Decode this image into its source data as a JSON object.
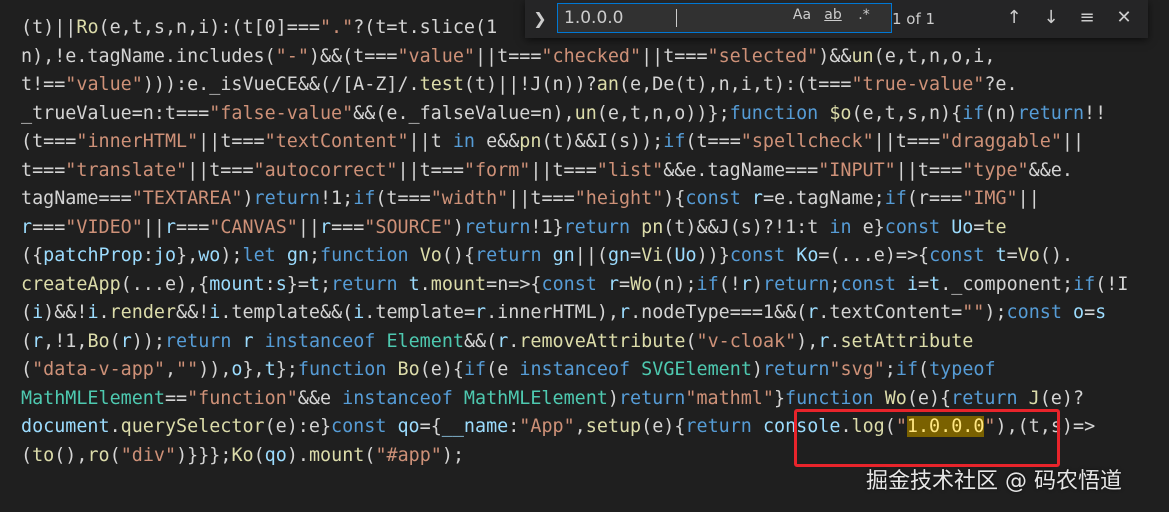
{
  "find": {
    "query": "1.0.0.0",
    "match_case_label": "Aa",
    "whole_word_label": "ab",
    "regex_label": ".*",
    "result_count": "1 of 1"
  },
  "code_lines": [
    [
      [
        "w",
        "(t)||"
      ],
      [
        "f",
        "Ro"
      ],
      [
        "w",
        "(e,t,s,n,i):(t[0]==="
      ],
      [
        "s",
        "\".\""
      ],
      [
        "w",
        "?(t=t.slice(1"
      ]
    ],
    [
      [
        "w",
        "n),!e.tagName.includes("
      ],
      [
        "s",
        "\"-\""
      ],
      [
        "w",
        ")&&(t==="
      ],
      [
        "s",
        "\"value\""
      ],
      [
        "w",
        "||t==="
      ],
      [
        "s",
        "\"checked\""
      ],
      [
        "w",
        "||t==="
      ],
      [
        "s",
        "\"selected\""
      ],
      [
        "w",
        ")&&"
      ],
      [
        "f",
        "un"
      ],
      [
        "w",
        "(e,t,n,o,i,"
      ]
    ],
    [
      [
        "w",
        "t!=="
      ],
      [
        "s",
        "\"value\""
      ],
      [
        "w",
        "))):e._isVueCE&&(/[A-Z]/."
      ],
      [
        "f",
        "test"
      ],
      [
        "w",
        "(t)||!J(n))?"
      ],
      [
        "f",
        "an"
      ],
      [
        "w",
        "(e,De(t),n,i,t):(t==="
      ],
      [
        "s",
        "\"true-value\""
      ],
      [
        "w",
        "?e."
      ]
    ],
    [
      [
        "w",
        "_trueValue=n:t==="
      ],
      [
        "s",
        "\"false-value\""
      ],
      [
        "w",
        "&&(e._falseValue=n),"
      ],
      [
        "f",
        "un"
      ],
      [
        "w",
        "(e,t,n,o))};"
      ],
      [
        "k",
        "function "
      ],
      [
        "f",
        "$o"
      ],
      [
        "w",
        "(e,t,s,n){"
      ],
      [
        "k",
        "if"
      ],
      [
        "w",
        "(n)"
      ],
      [
        "k",
        "return"
      ],
      [
        "w",
        "!!"
      ]
    ],
    [
      [
        "w",
        "(t==="
      ],
      [
        "s",
        "\"innerHTML\""
      ],
      [
        "w",
        "||t==="
      ],
      [
        "s",
        "\"textContent\""
      ],
      [
        "w",
        "||t "
      ],
      [
        "k",
        "in"
      ],
      [
        "w",
        " e&&"
      ],
      [
        "f",
        "pn"
      ],
      [
        "w",
        "(t)&&I(s));"
      ],
      [
        "k",
        "if"
      ],
      [
        "w",
        "(t==="
      ],
      [
        "s",
        "\"spellcheck\""
      ],
      [
        "w",
        "||t==="
      ],
      [
        "s",
        "\"draggable\""
      ],
      [
        "w",
        "||"
      ]
    ],
    [
      [
        "w",
        "t==="
      ],
      [
        "s",
        "\"translate\""
      ],
      [
        "w",
        "||t==="
      ],
      [
        "s",
        "\"autocorrect\""
      ],
      [
        "w",
        "||t==="
      ],
      [
        "s",
        "\"form\""
      ],
      [
        "w",
        "||t==="
      ],
      [
        "s",
        "\"list\""
      ],
      [
        "w",
        "&&e.tagName==="
      ],
      [
        "s",
        "\"INPUT\""
      ],
      [
        "w",
        "||t==="
      ],
      [
        "s",
        "\"type\""
      ],
      [
        "w",
        "&&e."
      ]
    ],
    [
      [
        "w",
        "tagName==="
      ],
      [
        "s",
        "\"TEXTAREA\""
      ],
      [
        "w",
        ")"
      ],
      [
        "k",
        "return"
      ],
      [
        "w",
        "!1;"
      ],
      [
        "k",
        "if"
      ],
      [
        "w",
        "(t==="
      ],
      [
        "s",
        "\"width\""
      ],
      [
        "w",
        "||t==="
      ],
      [
        "s",
        "\"height\""
      ],
      [
        "w",
        "){"
      ],
      [
        "k",
        "const "
      ],
      [
        "v",
        "r"
      ],
      [
        "w",
        "=e.tagName;"
      ],
      [
        "k",
        "if"
      ],
      [
        "w",
        "(r==="
      ],
      [
        "s",
        "\"IMG\""
      ],
      [
        "w",
        "||"
      ]
    ],
    [
      [
        "v",
        "r"
      ],
      [
        "w",
        "==="
      ],
      [
        "s",
        "\"VIDEO\""
      ],
      [
        "w",
        "||"
      ],
      [
        "v",
        "r"
      ],
      [
        "w",
        "==="
      ],
      [
        "s",
        "\"CANVAS\""
      ],
      [
        "w",
        "||"
      ],
      [
        "v",
        "r"
      ],
      [
        "w",
        "==="
      ],
      [
        "s",
        "\"SOURCE\""
      ],
      [
        "w",
        ")"
      ],
      [
        "k",
        "return"
      ],
      [
        "w",
        "!1}"
      ],
      [
        "k",
        "return "
      ],
      [
        "f",
        "pn"
      ],
      [
        "w",
        "(t)&&J(s)?!1:t "
      ],
      [
        "k",
        "in"
      ],
      [
        "w",
        " e}"
      ],
      [
        "k",
        "const "
      ],
      [
        "v",
        "Uo"
      ],
      [
        "w",
        "="
      ],
      [
        "f",
        "te"
      ]
    ],
    [
      [
        "w",
        "({"
      ],
      [
        "v",
        "patchProp"
      ],
      [
        "w",
        ":"
      ],
      [
        "v",
        "jo"
      ],
      [
        "w",
        "},"
      ],
      [
        "v",
        "wo"
      ],
      [
        "w",
        ");"
      ],
      [
        "k",
        "let "
      ],
      [
        "v",
        "gn"
      ],
      [
        "w",
        ";"
      ],
      [
        "k",
        "function "
      ],
      [
        "f",
        "Vo"
      ],
      [
        "w",
        "(){"
      ],
      [
        "k",
        "return "
      ],
      [
        "v",
        "gn"
      ],
      [
        "w",
        "||("
      ],
      [
        "v",
        "gn"
      ],
      [
        "w",
        "="
      ],
      [
        "f",
        "Vi"
      ],
      [
        "w",
        "("
      ],
      [
        "v",
        "Uo"
      ],
      [
        "w",
        "))}"
      ],
      [
        "k",
        "const "
      ],
      [
        "v",
        "Ko"
      ],
      [
        "w",
        "=(...e)=>{"
      ],
      [
        "k",
        "const "
      ],
      [
        "v",
        "t"
      ],
      [
        "w",
        "="
      ],
      [
        "f",
        "Vo"
      ],
      [
        "w",
        "()."
      ]
    ],
    [
      [
        "f",
        "createApp"
      ],
      [
        "w",
        "(...e),{"
      ],
      [
        "v",
        "mount"
      ],
      [
        "w",
        ":"
      ],
      [
        "v",
        "s"
      ],
      [
        "w",
        "}="
      ],
      [
        "v",
        "t"
      ],
      [
        "w",
        ";"
      ],
      [
        "k",
        "return "
      ],
      [
        "v",
        "t"
      ],
      [
        "w",
        "."
      ],
      [
        "f",
        "mount"
      ],
      [
        "w",
        "=n=>{"
      ],
      [
        "k",
        "const "
      ],
      [
        "v",
        "r"
      ],
      [
        "w",
        "="
      ],
      [
        "f",
        "Wo"
      ],
      [
        "w",
        "(n);"
      ],
      [
        "k",
        "if"
      ],
      [
        "w",
        "(!"
      ],
      [
        "v",
        "r"
      ],
      [
        "w",
        ")"
      ],
      [
        "k",
        "return"
      ],
      [
        "w",
        ";"
      ],
      [
        "k",
        "const "
      ],
      [
        "v",
        "i"
      ],
      [
        "w",
        "="
      ],
      [
        "v",
        "t"
      ],
      [
        "w",
        "._component;"
      ],
      [
        "k",
        "if"
      ],
      [
        "w",
        "(!I"
      ]
    ],
    [
      [
        "w",
        "("
      ],
      [
        "v",
        "i"
      ],
      [
        "w",
        ")&&!"
      ],
      [
        "v",
        "i"
      ],
      [
        "w",
        "."
      ],
      [
        "f",
        "render"
      ],
      [
        "w",
        "&&!"
      ],
      [
        "v",
        "i"
      ],
      [
        "w",
        ".template&&("
      ],
      [
        "v",
        "i"
      ],
      [
        "w",
        ".template="
      ],
      [
        "v",
        "r"
      ],
      [
        "w",
        ".innerHTML),"
      ],
      [
        "v",
        "r"
      ],
      [
        "w",
        ".nodeType===1&&("
      ],
      [
        "v",
        "r"
      ],
      [
        "w",
        ".textContent="
      ],
      [
        "s",
        "\"\""
      ],
      [
        "w",
        ");"
      ],
      [
        "k",
        "const "
      ],
      [
        "v",
        "o"
      ],
      [
        "w",
        "="
      ],
      [
        "v",
        "s"
      ]
    ],
    [
      [
        "w",
        "("
      ],
      [
        "v",
        "r"
      ],
      [
        "w",
        ",!1,"
      ],
      [
        "f",
        "Bo"
      ],
      [
        "w",
        "("
      ],
      [
        "v",
        "r"
      ],
      [
        "w",
        "));"
      ],
      [
        "k",
        "return "
      ],
      [
        "v",
        "r"
      ],
      [
        "k",
        " instanceof "
      ],
      [
        "t",
        "Element"
      ],
      [
        "w",
        "&&("
      ],
      [
        "v",
        "r"
      ],
      [
        "w",
        "."
      ],
      [
        "f",
        "removeAttribute"
      ],
      [
        "w",
        "("
      ],
      [
        "s",
        "\"v-cloak\""
      ],
      [
        "w",
        "),"
      ],
      [
        "v",
        "r"
      ],
      [
        "w",
        "."
      ],
      [
        "f",
        "setAttribute"
      ]
    ],
    [
      [
        "w",
        "("
      ],
      [
        "s",
        "\"data-v-app\""
      ],
      [
        "w",
        ","
      ],
      [
        "s",
        "\"\""
      ],
      [
        "w",
        ")),"
      ],
      [
        "v",
        "o"
      ],
      [
        "w",
        "},"
      ],
      [
        "v",
        "t"
      ],
      [
        "w",
        "};"
      ],
      [
        "k",
        "function "
      ],
      [
        "f",
        "Bo"
      ],
      [
        "w",
        "(e){"
      ],
      [
        "k",
        "if"
      ],
      [
        "w",
        "(e"
      ],
      [
        "k",
        " instanceof "
      ],
      [
        "t",
        "SVGElement"
      ],
      [
        "w",
        ")"
      ],
      [
        "k",
        "return"
      ],
      [
        "s",
        "\"svg\""
      ],
      [
        "w",
        ";"
      ],
      [
        "k",
        "if"
      ],
      [
        "w",
        "("
      ],
      [
        "k",
        "typeof"
      ]
    ],
    [
      [
        "t",
        "MathMLElement"
      ],
      [
        "w",
        "=="
      ],
      [
        "s",
        "\"function\""
      ],
      [
        "w",
        "&&e"
      ],
      [
        "k",
        " instanceof "
      ],
      [
        "t",
        "MathMLElement"
      ],
      [
        "w",
        ")"
      ],
      [
        "k",
        "return"
      ],
      [
        "s",
        "\"mathml\""
      ],
      [
        "w",
        "}"
      ],
      [
        "k",
        "function "
      ],
      [
        "f",
        "Wo"
      ],
      [
        "w",
        "(e){"
      ],
      [
        "k",
        "return "
      ],
      [
        "f",
        "J"
      ],
      [
        "w",
        "(e)?"
      ]
    ],
    [
      [
        "v",
        "document"
      ],
      [
        "w",
        "."
      ],
      [
        "f",
        "querySelector"
      ],
      [
        "w",
        "(e):e}"
      ],
      [
        "k",
        "const "
      ],
      [
        "v",
        "qo"
      ],
      [
        "w",
        "={"
      ],
      [
        "v",
        "__name"
      ],
      [
        "w",
        ":"
      ],
      [
        "s",
        "\"App\""
      ],
      [
        "w",
        ","
      ],
      [
        "f",
        "setup"
      ],
      [
        "w",
        "(e){"
      ],
      [
        "k",
        "return "
      ],
      [
        "v",
        "console"
      ],
      [
        "w",
        "."
      ],
      [
        "f",
        "log"
      ],
      [
        "w",
        "("
      ],
      [
        "s",
        "\""
      ],
      [
        "hl",
        "1.0.0.0"
      ],
      [
        "s",
        "\""
      ],
      [
        "w",
        "),(t,s)=>"
      ]
    ],
    [
      [
        "w",
        "("
      ],
      [
        "f",
        "to"
      ],
      [
        "w",
        "(),"
      ],
      [
        "f",
        "ro"
      ],
      [
        "w",
        "("
      ],
      [
        "s",
        "\"div\""
      ],
      [
        "w",
        ")}}};"
      ],
      [
        "f",
        "Ko"
      ],
      [
        "w",
        "("
      ],
      [
        "v",
        "qo"
      ],
      [
        "w",
        ")."
      ],
      [
        "f",
        "mount"
      ],
      [
        "w",
        "("
      ],
      [
        "s",
        "\"#app\""
      ],
      [
        "w",
        ");"
      ]
    ]
  ],
  "watermark": "掘金技术社区 @ 码农悟道",
  "colors": {
    "background": "#1f1f1f",
    "keyword": "#569cd6",
    "string": "#ce9178",
    "function": "#dcdcaa",
    "variable": "#9cdcfe",
    "type": "#4ec9b0",
    "match_highlight": "#7a6100",
    "annotation_box": "#e8242b"
  }
}
